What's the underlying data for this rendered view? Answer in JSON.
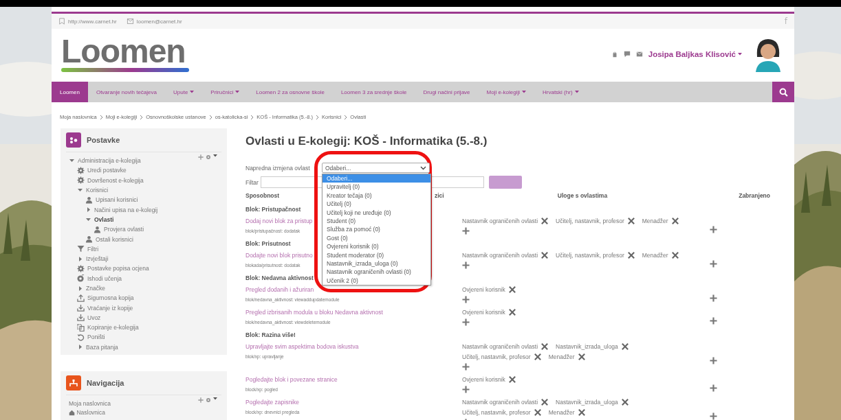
{
  "top_bar": {
    "website": "http://www.carnet.hr",
    "email": "loomen@carnet.hr",
    "social": "f"
  },
  "header": {
    "logo": "Loomen",
    "user_name": "Josipa Baljkas Klisović"
  },
  "nav": [
    {
      "label": "Loomen",
      "dropdown": false,
      "selected": true
    },
    {
      "label": "Otvaranje novih tečajeva",
      "dropdown": false,
      "selected": false
    },
    {
      "label": "Upute",
      "dropdown": true,
      "selected": false
    },
    {
      "label": "Priručnici",
      "dropdown": true,
      "selected": false
    },
    {
      "label": "Loomen 2 za osnovne škole",
      "dropdown": false,
      "selected": false
    },
    {
      "label": "Loomen 3 za srednje škole",
      "dropdown": false,
      "selected": false
    },
    {
      "label": "Drugi načini prijave",
      "dropdown": false,
      "selected": false
    },
    {
      "label": "Moji e-kolegiji",
      "dropdown": true,
      "selected": false
    },
    {
      "label": "Hrvatski (hr)",
      "dropdown": true,
      "selected": false
    }
  ],
  "breadcrumb": [
    "Moja naslovnica",
    "Moji e-kolegiji",
    "Osnovnoškolske ustanove",
    "os-katolicka-si",
    "KOŠ - Informatika (5.-8.)",
    "Korisnici",
    "Ovlasti"
  ],
  "settings_block": {
    "title": "Postavke",
    "tree": [
      {
        "label": "Administracija e-kolegija",
        "expanded": true,
        "selected": false,
        "children": [
          {
            "label": "Uredi postavke",
            "kind": "gear",
            "selected": false
          },
          {
            "label": "Dovršenost e-kolegija",
            "kind": "gear",
            "selected": false
          },
          {
            "label": "Korisnici",
            "expanded": true,
            "selected": false,
            "children": [
              {
                "label": "Upisani korisnici",
                "kind": "user",
                "selected": false
              },
              {
                "label": "Načini upisa na e-kolegij",
                "expanded": false,
                "selected": false
              },
              {
                "label": "Ovlasti",
                "expanded": true,
                "selected": true,
                "children": [
                  {
                    "label": "Provjera ovlasti",
                    "kind": "user",
                    "selected": false
                  }
                ]
              },
              {
                "label": "Ostali korisnici",
                "kind": "user",
                "selected": false
              }
            ]
          },
          {
            "label": "Filtri",
            "kind": "filter",
            "selected": false
          },
          {
            "label": "Izvještaji",
            "expanded": false,
            "selected": false
          },
          {
            "label": "Postavke popisa ocjena",
            "kind": "gear",
            "selected": false
          },
          {
            "label": "Ishodi učenja",
            "kind": "target",
            "selected": false
          },
          {
            "label": "Značke",
            "expanded": false,
            "selected": false
          },
          {
            "label": "Sigurnosna kopija",
            "kind": "upload",
            "selected": false
          },
          {
            "label": "Vraćanje iz kopije",
            "kind": "download",
            "selected": false
          },
          {
            "label": "Uvoz",
            "kind": "download",
            "selected": false
          },
          {
            "label": "Kopiranje e-kolegija",
            "kind": "copy",
            "selected": false
          },
          {
            "label": "Poništi",
            "kind": "undo",
            "selected": false
          },
          {
            "label": "Baza pitanja",
            "expanded": false,
            "selected": false
          }
        ]
      }
    ]
  },
  "navigation_block": {
    "title": "Navigacija",
    "items": [
      {
        "label": "Moja naslovnica",
        "kind": "text"
      },
      {
        "label": "Naslovnica",
        "kind": "home"
      }
    ]
  },
  "page": {
    "title": "Ovlasti u E-kolegij: KOŠ - Informatika (5.-8.)",
    "advanced_label": "Napredna izmjena ovlast",
    "role_select": {
      "value": "Odaberi...",
      "expanded": true,
      "options": [
        {
          "label": "Odaberi...",
          "selected": true
        },
        {
          "label": "Upravitelj (0)",
          "selected": false
        },
        {
          "label": "Kreator tečaja (0)",
          "selected": false
        },
        {
          "label": "Učitelj (0)",
          "selected": false
        },
        {
          "label": "Učitelj koji ne uređuje (0)",
          "selected": false
        },
        {
          "label": "Student (0)",
          "selected": false
        },
        {
          "label": "Služba za pomoć (0)",
          "selected": false
        },
        {
          "label": "Gost (0)",
          "selected": false
        },
        {
          "label": "Ovjereni korisnik (0)",
          "selected": false
        },
        {
          "label": "Student moderator (0)",
          "selected": false
        },
        {
          "label": "Nastavnik_izrada_uloga (0)",
          "selected": false
        },
        {
          "label": "Nastavnik ograničenih ovlasti (0)",
          "selected": false
        },
        {
          "label": "Učenik 2 (0)",
          "selected": false
        }
      ]
    },
    "filter_label": "Filtar"
  },
  "table": {
    "columns": [
      "Sposobnost",
      "zici",
      "Uloge s ovlastima",
      "Zabranjeno"
    ],
    "rows": [
      {
        "kind": "section",
        "title": "Blok: Pristupačnost"
      },
      {
        "kind": "capability",
        "link": "Dodaj novi blok za pristup",
        "path": "blok/pristupačnost: dodatak",
        "roles": [
          "Nastavnik ograničenih ovlasti",
          "Učitelj, nastavnik, profesor",
          "Menadžer"
        ]
      },
      {
        "kind": "section",
        "title": "Blok: Prisutnost"
      },
      {
        "kind": "capability",
        "link": "Dodajte novi blok prisutno",
        "path": "blokada/prisutnost: dodatak",
        "roles": [
          "Nastavnik ograničenih ovlasti",
          "Učitelj, nastavnik, profesor",
          "Menadžer"
        ]
      },
      {
        "kind": "section",
        "title": "Blok: Nedavna aktivnost"
      },
      {
        "kind": "capability",
        "link": "Pregled dodanih i ažuriran",
        "path": "blok/nedavna_aktivnost: viewaddupdatemodule",
        "roles": [
          "Ovjereni korisnik"
        ]
      },
      {
        "kind": "capability",
        "link": "Pregled izbrisanih modula u bloku Nedavna aktivnost",
        "path": "blok/nedavna_aktivnost: viewdeletemodule",
        "roles": [
          "Ovjereni korisnik"
        ]
      },
      {
        "kind": "section",
        "title": "Blok: Razina više!"
      },
      {
        "kind": "capability",
        "link": "Upravljajte svim aspektima bodova iskustva",
        "path": "blok/xp: upravljanje",
        "roles": [
          "Nastavnik ograničenih ovlasti",
          "Nastavnik_izrada_uloga",
          "Učitelj, nastavnik, profesor",
          "Menadžer"
        ]
      },
      {
        "kind": "capability",
        "link": "Pogledajte blok i povezane stranice",
        "path": "block/xp: pogled",
        "roles": [
          "Ovjereni korisnik"
        ]
      },
      {
        "kind": "capability",
        "link": "Pogledajte zapisnike",
        "path": "block/xp: dnevnici pregleda",
        "roles": [
          "Nastavnik ograničenih ovlasti",
          "Nastavnik_izrada_uloga",
          "Učitelj, nastavnik, profesor",
          "Menadžer"
        ]
      }
    ]
  }
}
